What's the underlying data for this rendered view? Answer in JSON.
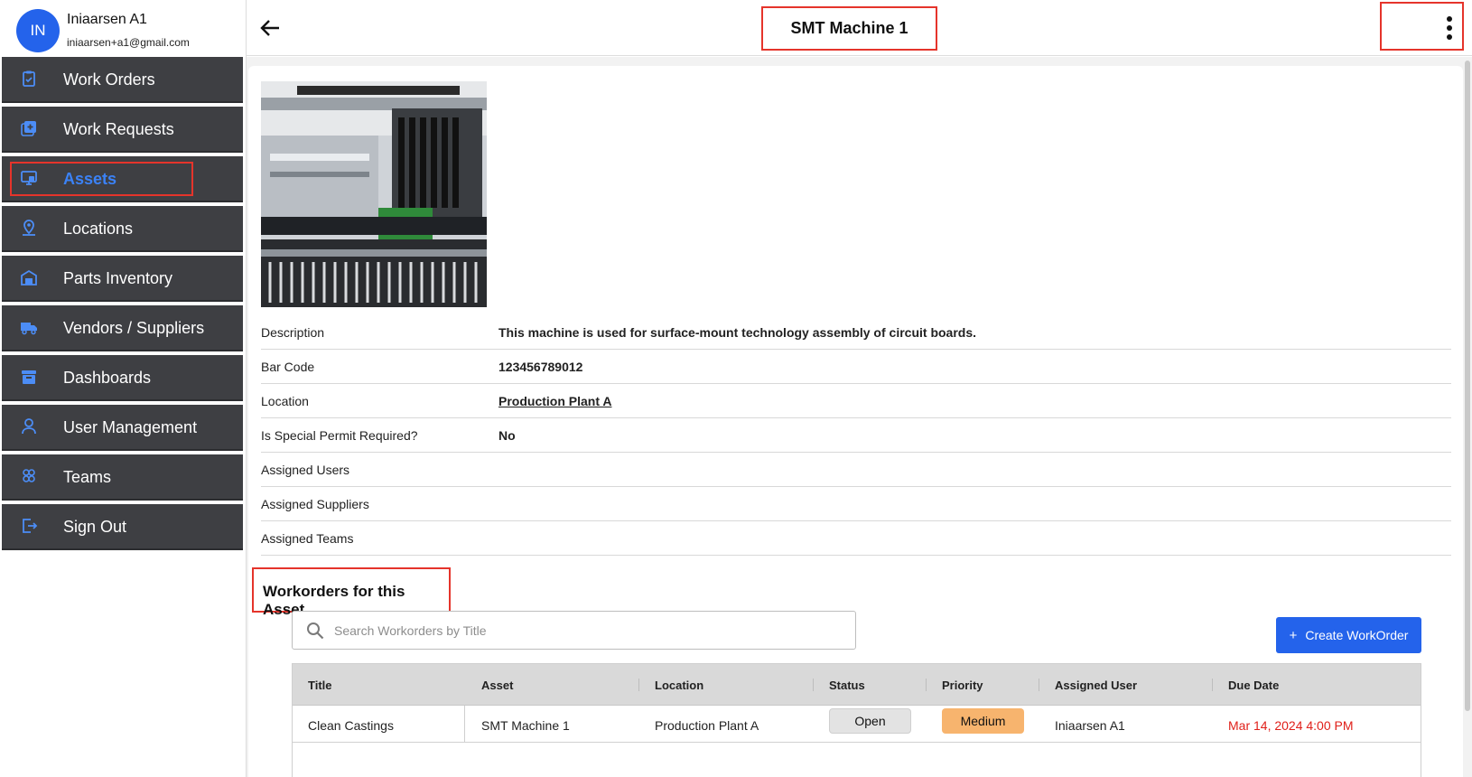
{
  "user": {
    "initials": "IN",
    "name": "Iniaarsen A1",
    "email": "iniaarsen+a1@gmail.com"
  },
  "nav": {
    "items": [
      {
        "label": "Work Orders",
        "icon": "clipboard-icon"
      },
      {
        "label": "Work Requests",
        "icon": "plus-square-icon"
      },
      {
        "label": "Assets",
        "icon": "monitor-icon",
        "active": true
      },
      {
        "label": "Locations",
        "icon": "location-pin-icon"
      },
      {
        "label": "Parts Inventory",
        "icon": "warehouse-icon"
      },
      {
        "label": "Vendors / Suppliers",
        "icon": "truck-icon"
      },
      {
        "label": "Dashboards",
        "icon": "archive-icon"
      },
      {
        "label": "User Management",
        "icon": "user-icon"
      },
      {
        "label": "Teams",
        "icon": "team-icon"
      },
      {
        "label": "Sign Out",
        "icon": "sign-out-icon"
      }
    ]
  },
  "header": {
    "title": "SMT Machine 1"
  },
  "asset": {
    "details": [
      {
        "key": "Description",
        "value": "This machine is used for surface-mount technology assembly of circuit boards."
      },
      {
        "key": "Bar Code",
        "value": "123456789012"
      },
      {
        "key": "Location",
        "value": "Production Plant A",
        "link": true
      },
      {
        "key": "Is Special Permit Required?",
        "value": "No"
      },
      {
        "key": "Assigned Users",
        "value": ""
      },
      {
        "key": "Assigned Suppliers",
        "value": ""
      },
      {
        "key": "Assigned Teams",
        "value": ""
      }
    ]
  },
  "workorders": {
    "heading": "Workorders for this Asset",
    "search_placeholder": "Search Workorders by Title",
    "create_label": "Create WorkOrder",
    "columns": [
      "Title",
      "Asset",
      "Location",
      "Status",
      "Priority",
      "Assigned User",
      "Due Date"
    ],
    "rows": [
      {
        "title": "Clean Castings",
        "asset": "SMT Machine 1",
        "location": "Production Plant A",
        "status": "Open",
        "priority": "Medium",
        "assigned_user": "Iniaarsen A1",
        "due_date": "Mar 14, 2024 4:00 PM"
      }
    ]
  },
  "colors": {
    "accent": "#2463eb",
    "nav_bg": "#3e3f43",
    "active_text": "#3b82f6",
    "highlight": "#e5342b",
    "priority_medium": "#f7b46e",
    "due_date": "#e0201a"
  }
}
